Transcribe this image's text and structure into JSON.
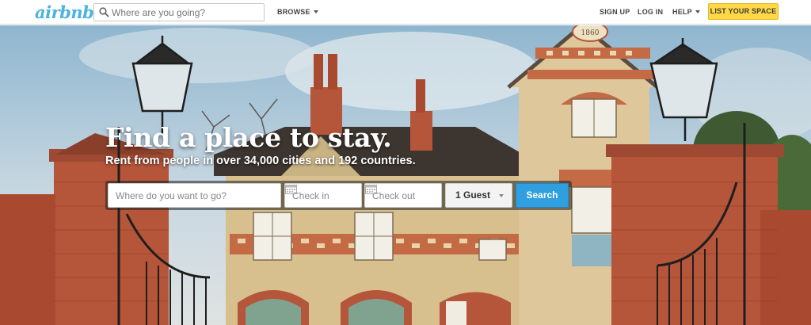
{
  "header": {
    "logo_text": "airbnb",
    "search_placeholder": "Where are you going?",
    "browse_label": "BROWSE",
    "signup_label": "SIGN UP",
    "login_label": "LOG IN",
    "help_label": "HELP",
    "list_space_label": "LIST YOUR SPACE"
  },
  "hero": {
    "title": "Find a place to stay.",
    "subtitle": "Rent from people in over 34,000 cities and 192 countries.",
    "date_sign": "1860"
  },
  "search_bar": {
    "destination_placeholder": "Where do you want to go?",
    "checkin_placeholder": "Check in",
    "checkout_placeholder": "Check out",
    "guests_value": "1 Guest",
    "search_label": "Search"
  },
  "icons": {
    "search": "search-icon",
    "calendar": "calendar-icon",
    "caret": "chevron-down-icon"
  },
  "colors": {
    "brand": "#4bb3dd",
    "list_button": "#ffd846",
    "search_button": "#2f9fe0",
    "brick": "#b5553a"
  }
}
